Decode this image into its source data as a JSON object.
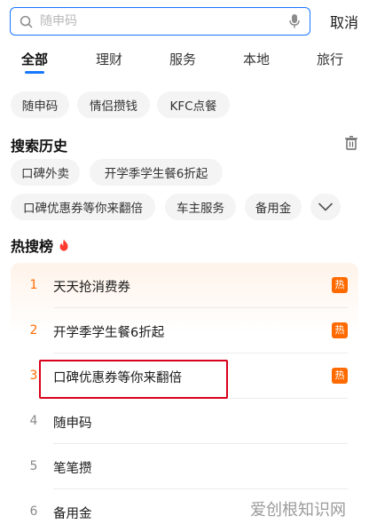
{
  "search": {
    "placeholder": "随申码",
    "cancel_label": "取消"
  },
  "tabs": [
    {
      "label": "全部",
      "active": true
    },
    {
      "label": "理财",
      "active": false
    },
    {
      "label": "服务",
      "active": false
    },
    {
      "label": "本地",
      "active": false
    },
    {
      "label": "旅行",
      "active": false
    }
  ],
  "suggestions": [
    "随申码",
    "情侣攒钱",
    "KFC点餐"
  ],
  "history": {
    "title": "搜索历史",
    "items": [
      "口碑外卖",
      "开学季学生餐6折起",
      "口碑优惠券等你来翻倍",
      "车主服务",
      "备用金"
    ]
  },
  "hot": {
    "title": "热搜榜",
    "badge_label": "热",
    "items": [
      {
        "rank": "1",
        "title": "天天抢消费券",
        "hot": true
      },
      {
        "rank": "2",
        "title": "开学季学生餐6折起",
        "hot": true
      },
      {
        "rank": "3",
        "title": "口碑优惠券等你来翻倍",
        "hot": true
      },
      {
        "rank": "4",
        "title": "随申码",
        "hot": false
      },
      {
        "rank": "5",
        "title": "笔笔攒",
        "hot": false
      },
      {
        "rank": "6",
        "title": "备用金",
        "hot": false
      }
    ]
  },
  "watermark": {
    "text": "爱创根知识网"
  },
  "colors": {
    "accent": "#1677ff",
    "hot": "#ff6a00",
    "highlight": "#d9001b"
  }
}
